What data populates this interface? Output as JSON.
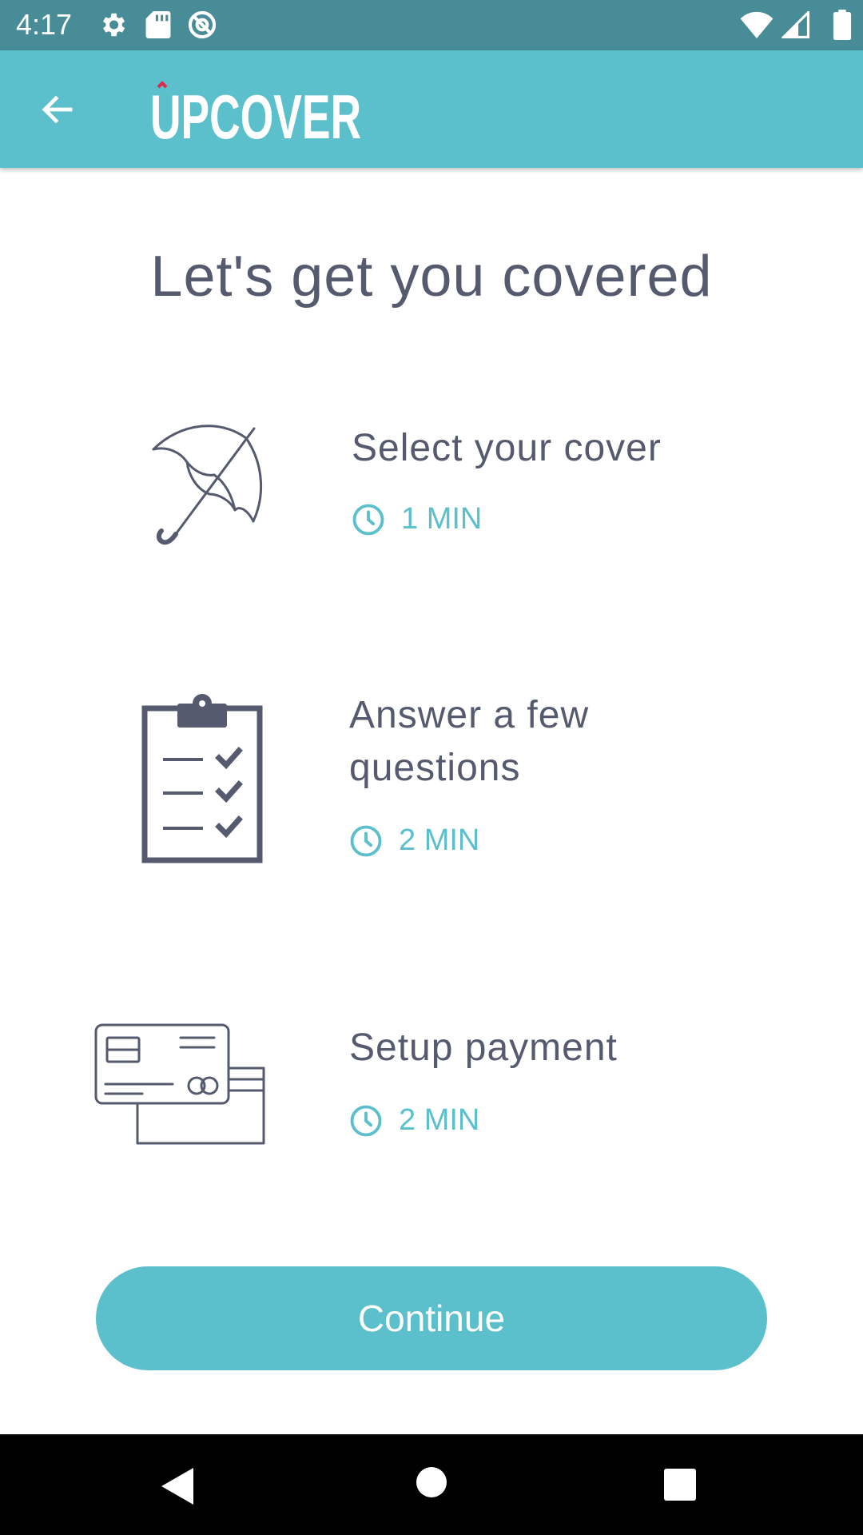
{
  "status_bar": {
    "time": "4:17",
    "icons_left": [
      "settings-icon",
      "sd-card-icon",
      "at-sign-icon"
    ],
    "icons_right": [
      "wifi-icon",
      "signal-icon",
      "battery-icon"
    ]
  },
  "app_bar": {
    "back_icon": "arrow-left-icon",
    "logo_text": "UPCOVER",
    "accent_color": "#5bc0cc",
    "logo_accent_color": "#e0284a"
  },
  "main": {
    "title": "Let's get you covered",
    "steps": [
      {
        "icon": "umbrella-icon",
        "title": "Select your cover",
        "time": "1 MIN"
      },
      {
        "icon": "clipboard-checklist-icon",
        "title": "Answer a few questions",
        "time": "2 MIN"
      },
      {
        "icon": "credit-cards-icon",
        "title": "Setup payment",
        "time": "2 MIN"
      }
    ],
    "time_icon": "clock-icon",
    "continue_label": "Continue"
  },
  "nav_bar": {
    "icons": [
      "nav-back-icon",
      "nav-home-icon",
      "nav-recents-icon"
    ]
  }
}
